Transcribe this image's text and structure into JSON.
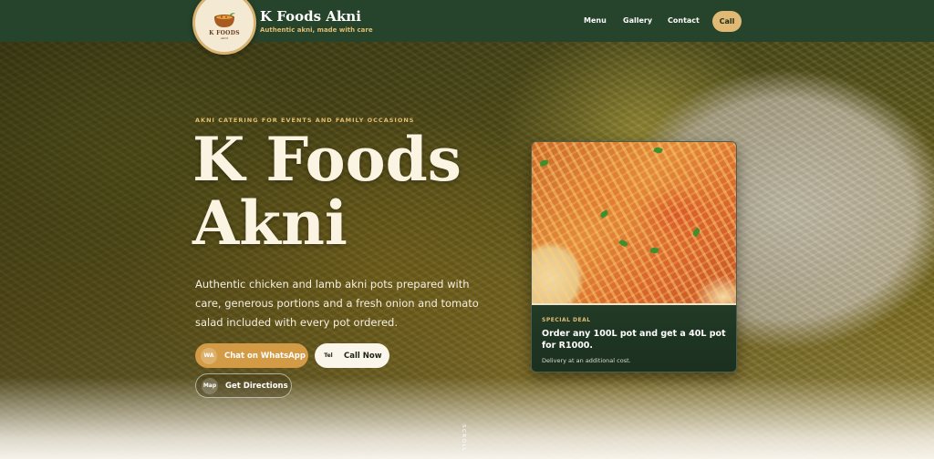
{
  "nav": {
    "brand_name": "K Foods Akni",
    "brand_tagline": "Authentic akni, made with care",
    "logo_text": "K FOODS",
    "logo_sub": "AKNI",
    "links": [
      {
        "label": "Menu"
      },
      {
        "label": "Gallery"
      },
      {
        "label": "Contact"
      }
    ],
    "call_label": "Call"
  },
  "hero": {
    "eyebrow": "AKNI CATERING FOR EVENTS AND FAMILY OCCASIONS",
    "title_line1": "K Foods",
    "title_line2": "Akni",
    "description": "Authentic chicken and lamb akni pots prepared with care, generous portions and a fresh onion and tomato salad included with every pot ordered.",
    "buttons": {
      "whatsapp": {
        "icon": "WA",
        "label": "Chat on WhatsApp"
      },
      "call": {
        "icon": "Tel",
        "label": "Call Now"
      },
      "directions": {
        "icon": "Map",
        "label": "Get Directions"
      }
    },
    "scroll_hint": "SCROLL"
  },
  "deal": {
    "label": "SPECIAL DEAL",
    "title": "Order any 100L pot and get a 40L pot for R1000.",
    "note": "Delivery at an additional cost."
  },
  "colors": {
    "nav_bg": "#26432b",
    "accent_gold": "#e2bd6f",
    "whatsapp_button": "#d39b46",
    "card_bg": "#1f3823"
  }
}
